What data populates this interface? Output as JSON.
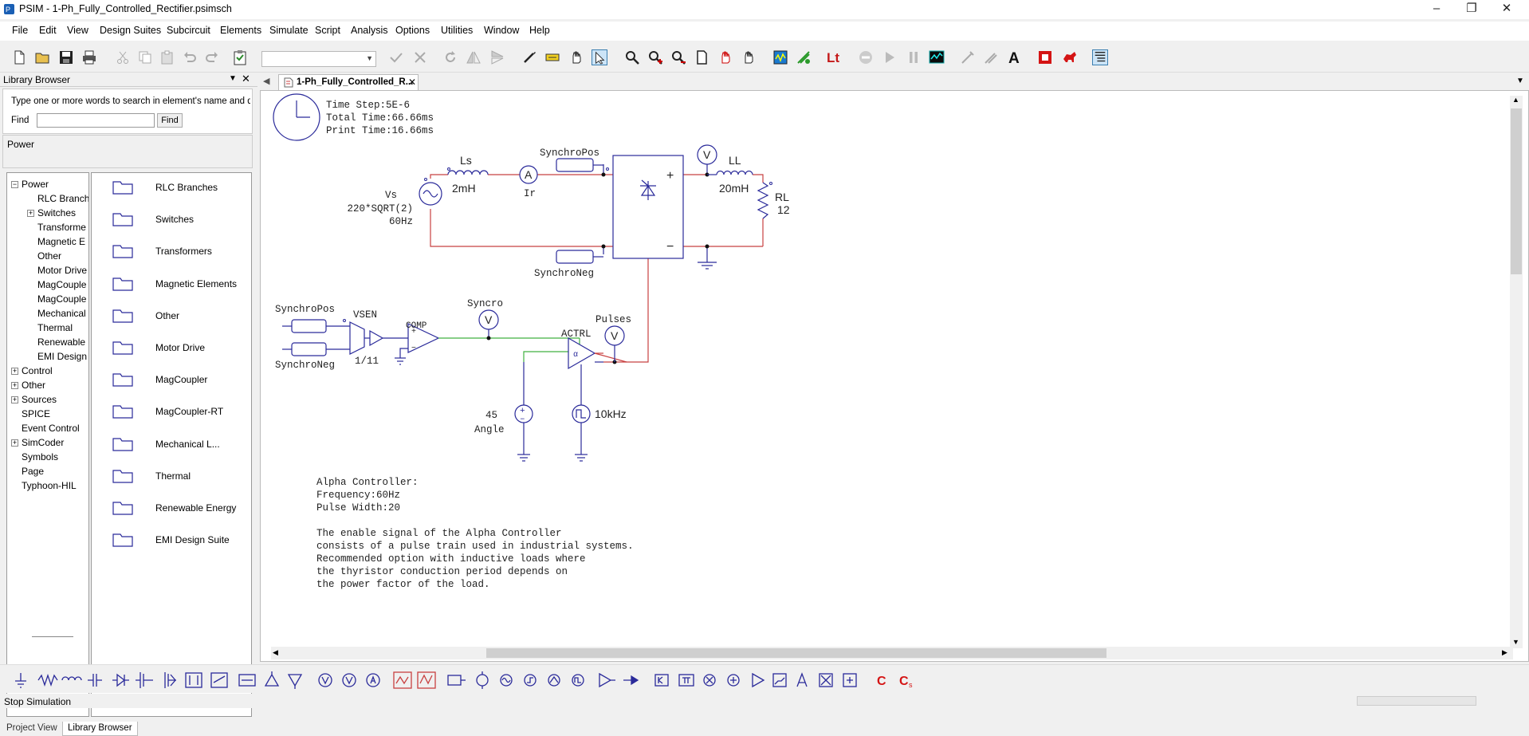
{
  "window": {
    "title": "PSIM - 1-Ph_Fully_Controlled_Rectifier.psimsch"
  },
  "menubar": [
    "File",
    "Edit",
    "View",
    "Design Suites",
    "Subcircuit",
    "Elements",
    "Simulate",
    "Script",
    "Analysis",
    "Options",
    "Utilities",
    "Window",
    "Help"
  ],
  "library": {
    "header": "Library Browser",
    "hint": "Type one or more words to search in element's name and desc",
    "find_label": "Find",
    "find_value": "",
    "find_button": "Find",
    "selected": "Power",
    "tree": [
      {
        "label": "Power",
        "level": 0,
        "expand": "minus"
      },
      {
        "label": "RLC Branch",
        "level": 1,
        "expand": ""
      },
      {
        "label": "Switches",
        "level": 1,
        "expand": "plus"
      },
      {
        "label": "Transforme",
        "level": 1,
        "expand": ""
      },
      {
        "label": "Magnetic E",
        "level": 1,
        "expand": ""
      },
      {
        "label": "Other",
        "level": 1,
        "expand": ""
      },
      {
        "label": "Motor Drive",
        "level": 1,
        "expand": ""
      },
      {
        "label": "MagCouple",
        "level": 1,
        "expand": ""
      },
      {
        "label": "MagCouple",
        "level": 1,
        "expand": ""
      },
      {
        "label": "Mechanical",
        "level": 1,
        "expand": ""
      },
      {
        "label": "Thermal",
        "level": 1,
        "expand": ""
      },
      {
        "label": "Renewable",
        "level": 1,
        "expand": ""
      },
      {
        "label": "EMI Design",
        "level": 1,
        "expand": ""
      },
      {
        "label": "Control",
        "level": 0,
        "expand": "plus"
      },
      {
        "label": "Other",
        "level": 0,
        "expand": "plus"
      },
      {
        "label": "Sources",
        "level": 0,
        "expand": "plus"
      },
      {
        "label": "SPICE",
        "level": 0,
        "expand": ""
      },
      {
        "label": "Event Control",
        "level": 0,
        "expand": ""
      },
      {
        "label": "SimCoder",
        "level": 0,
        "expand": "plus"
      },
      {
        "label": "Symbols",
        "level": 0,
        "expand": ""
      },
      {
        "label": "Page",
        "level": 0,
        "expand": ""
      },
      {
        "label": "Typhoon-HIL",
        "level": 0,
        "expand": ""
      }
    ],
    "folders": [
      "RLC Branches",
      "Switches",
      "Transformers",
      "Magnetic Elements",
      "Other",
      "Motor Drive",
      "MagCoupler",
      "MagCoupler-RT",
      "Mechanical L...",
      "Thermal",
      "Renewable Energy",
      "EMI Design Suite"
    ],
    "bottom_tabs": [
      "Project View",
      "Library Browser"
    ]
  },
  "document": {
    "tab": "1-Ph_Fully_Controlled_R..."
  },
  "schematic": {
    "sim": {
      "time_step": "Time Step:5E-6",
      "total_time": "Total Time:66.66ms",
      "print_time": "Print Time:16.66ms"
    },
    "labels": {
      "ls": "Ls",
      "ls_val": "2mH",
      "ammeter": "A",
      "ammeter_name": "Ir",
      "vs": "Vs",
      "vs_val": "220*SQRT(2)",
      "vs_freq": "60Hz",
      "synchro_pos": "SynchroPos",
      "synchro_neg": "SynchroNeg",
      "voltmeter": "V",
      "ll": "LL",
      "ll_val": "20mH",
      "rl": "RL",
      "rl_val": "12",
      "plus": "+",
      "minus": "−",
      "vsen": "VSEN",
      "vsen_gain": "1/11",
      "comp": "COMP",
      "syncro": "Syncro",
      "pulses": "Pulses",
      "actrl": "ACTRL",
      "angle_val": "45",
      "angle": "Angle",
      "freq": "10kHz"
    },
    "notes": [
      "Alpha Controller:",
      "Frequency:60Hz",
      "Pulse Width:20",
      "",
      "The enable signal of the Alpha Controller",
      "consists of a pulse train used in industrial systems.",
      "Recommended option with inductive loads where",
      "the thyristor conduction period depends on",
      "the power factor of the load."
    ],
    "colors": {
      "wire_red": "#c84040",
      "wire_green": "#40b040",
      "component": "#2a2a9a"
    }
  },
  "statusbar": {
    "text": "Stop Simulation"
  }
}
